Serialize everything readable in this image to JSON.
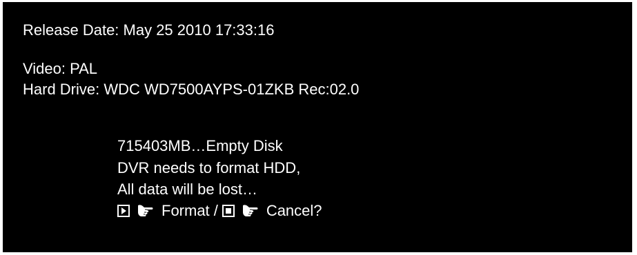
{
  "info": {
    "release_date": "Release Date: May 25 2010 17:33:16",
    "video": "Video: PAL",
    "hard_drive": "Hard Drive: WDC WD7500AYPS-01ZKB Rec:02.0"
  },
  "dialog": {
    "disk_status": "715403MB…Empty Disk",
    "format_notice": "DVR needs to format HDD,",
    "data_loss_warning": "All data will be lost…",
    "format_label": "Format",
    "separator": "/",
    "cancel_label": "Cancel?"
  },
  "icons": {
    "play": "play-button-icon",
    "stop": "stop-button-icon",
    "pointer": "pointing-hand-icon"
  },
  "colors": {
    "background": "#000000",
    "text": "#ffffff"
  }
}
